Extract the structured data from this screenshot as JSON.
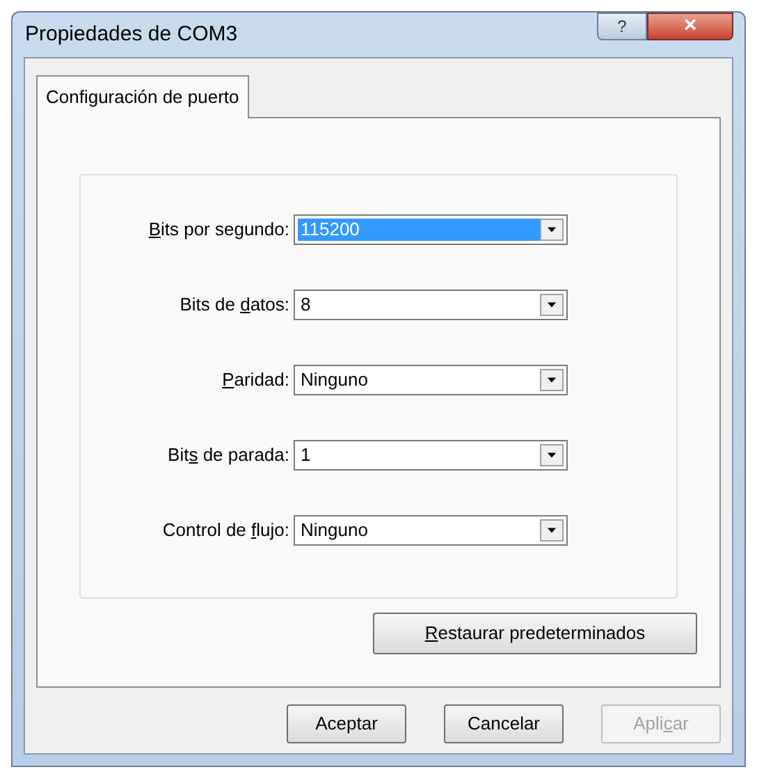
{
  "window": {
    "title": "Propiedades de COM3",
    "help": "?",
    "close": "×"
  },
  "tabs": [
    {
      "label": "Configuración de puerto",
      "selected": true
    }
  ],
  "fields": [
    {
      "access_key": "B",
      "label_after": "its por segundo:",
      "value": "115200",
      "focused": true
    },
    {
      "label_before": "Bits de ",
      "access_key": "d",
      "label_after": "atos:",
      "value": "8",
      "focused": false
    },
    {
      "access_key": "P",
      "label_after": "aridad:",
      "value": "Ninguno",
      "focused": false
    },
    {
      "label_before": "Bit",
      "access_key": "s",
      "label_after": " de parada:",
      "value": "1",
      "focused": false
    },
    {
      "label_before": "Control de ",
      "access_key": "f",
      "label_after": "lujo:",
      "value": "Ninguno",
      "focused": false
    }
  ],
  "restore_button": {
    "access_key": "R",
    "label_after": "estaurar predeterminados"
  },
  "buttons": [
    {
      "label_before": "Aceptar",
      "disabled": false
    },
    {
      "label_before": "Cancelar",
      "disabled": false
    },
    {
      "label_before": "Apli",
      "access_key": "c",
      "label_after": "ar",
      "disabled": true
    }
  ]
}
